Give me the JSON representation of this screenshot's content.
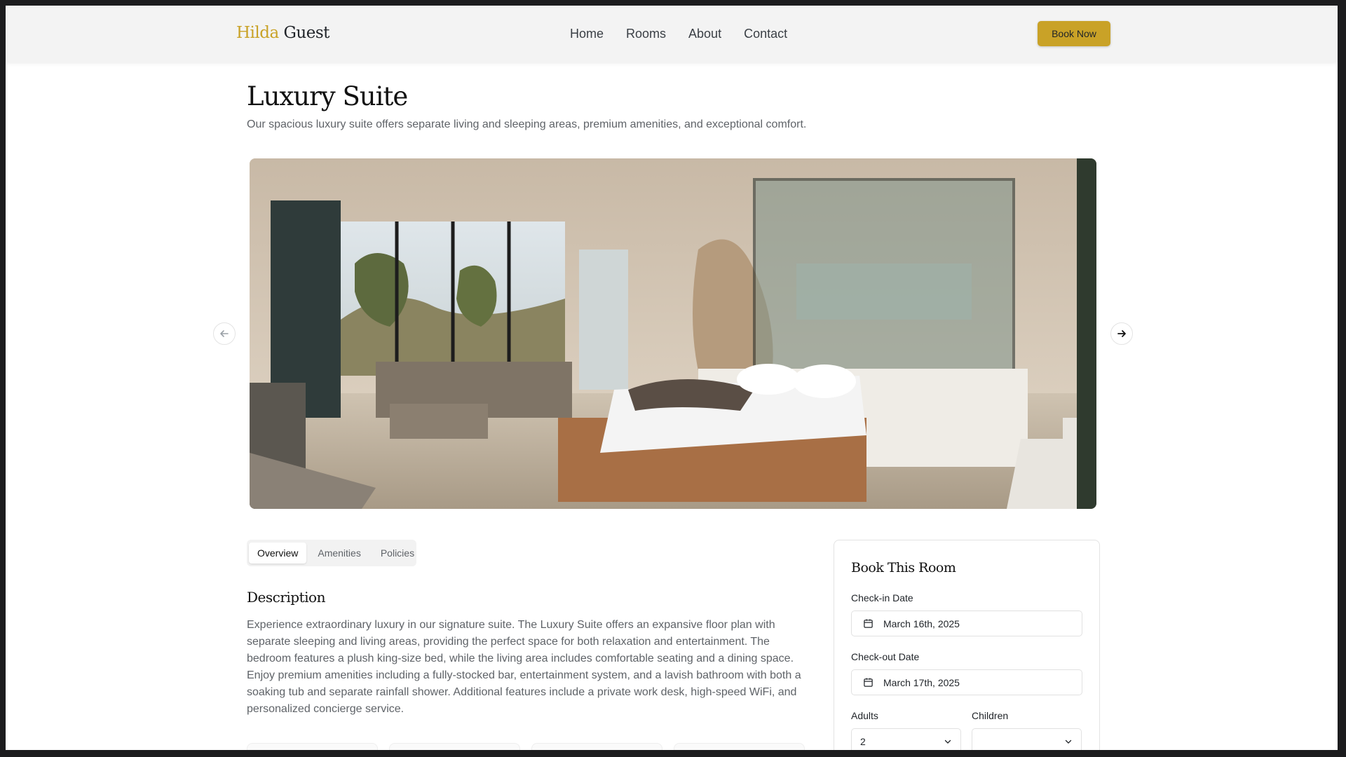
{
  "brand": {
    "first": "Hilda",
    "second": "Guest",
    "accent_color": "#c9a227"
  },
  "nav": {
    "items": [
      "Home",
      "Rooms",
      "About",
      "Contact"
    ]
  },
  "header": {
    "cta_label": "Book Now"
  },
  "room": {
    "title": "Luxury Suite",
    "subtitle": "Our spacious luxury suite offers separate living and sleeping areas, premium amenities, and exceptional comfort."
  },
  "carousel": {
    "prev_icon": "arrow-left-icon",
    "next_icon": "arrow-right-icon"
  },
  "tabs": [
    "Overview",
    "Amenities",
    "Policies"
  ],
  "active_tab": "Overview",
  "description": {
    "heading": "Description",
    "text": "Experience extraordinary luxury in our signature suite. The Luxury Suite offers an expansive floor plan with separate sleeping and living areas, providing the perfect space for both relaxation and entertainment. The bedroom features a plush king-size bed, while the living area includes comfortable seating and a dining space. Enjoy premium amenities including a fully-stocked bar, entertainment system, and a lavish bathroom with both a soaking tub and separate rainfall shower. Additional features include a private work desk, high-speed WiFi, and personalized concierge service."
  },
  "booking": {
    "heading": "Book This Room",
    "checkin_label": "Check-in Date",
    "checkin_value": "March 16th, 2025",
    "checkout_label": "Check-out Date",
    "checkout_value": "March 17th, 2025",
    "adults_label": "Adults",
    "adults_value": "2",
    "children_label": "Children",
    "children_value": ""
  }
}
